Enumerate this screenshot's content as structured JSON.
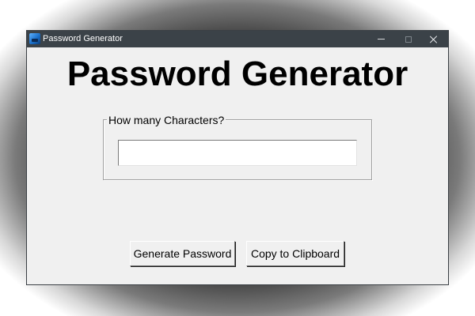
{
  "window": {
    "title": "Password Generator",
    "icon": "app-icon",
    "controls": {
      "minimize_icon": "minimize-icon",
      "maximize_icon": "maximize-icon",
      "close_icon": "close-icon"
    }
  },
  "main": {
    "heading": "Password Generator",
    "group": {
      "legend": "How many Characters?",
      "input": {
        "value": "",
        "placeholder": ""
      }
    },
    "buttons": {
      "generate_label": "Generate Password",
      "copy_label": "Copy to Clipboard"
    }
  },
  "colors": {
    "titlebar": "#3b4248",
    "window_bg": "#f0f0f0",
    "heading_text": "#000000"
  }
}
